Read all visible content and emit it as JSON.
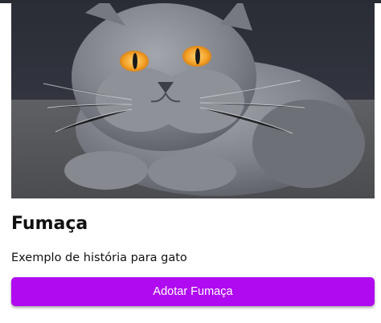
{
  "card": {
    "image_subject": "gray-british-shorthair-cat",
    "title": "Fumaça",
    "description": "Exemplo de história para gato",
    "button_label": "Adotar Fumaça"
  },
  "colors": {
    "accent": "#b00af1",
    "text": "#111111",
    "background": "#ffffff"
  }
}
